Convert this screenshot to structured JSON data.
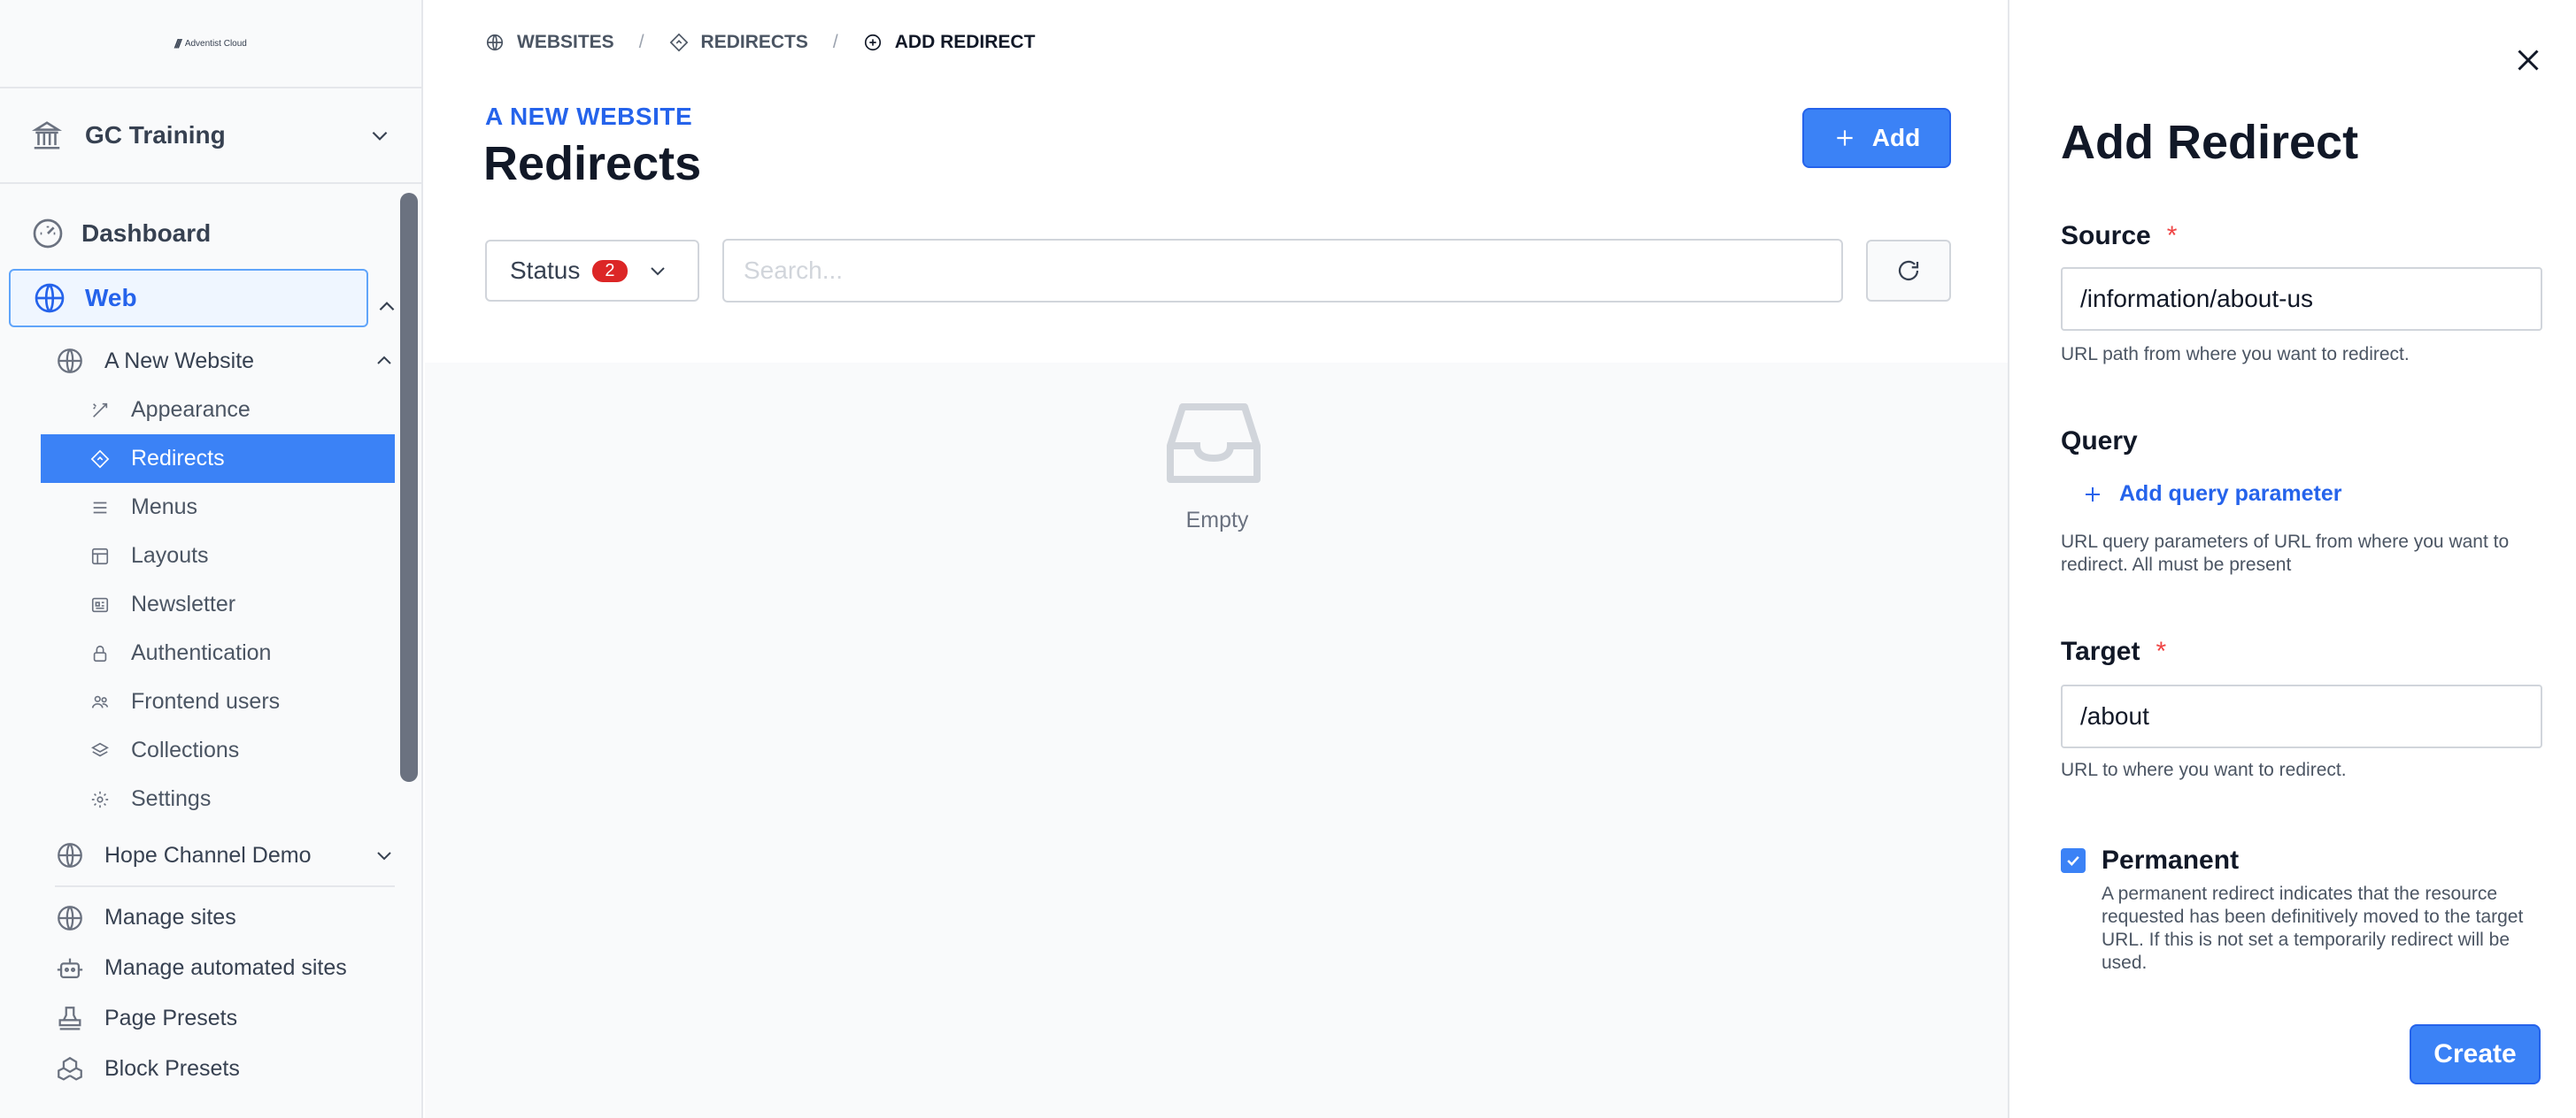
{
  "sidebar": {
    "logo_text": "Adventist Cloud",
    "org_name": "GC Training",
    "dashboard": "Dashboard",
    "web": "Web",
    "site_name": "A New Website",
    "subitems": [
      {
        "label": "Appearance",
        "icon": "wand-icon"
      },
      {
        "label": "Redirects",
        "icon": "diamond-arrow-icon"
      },
      {
        "label": "Menus",
        "icon": "list-icon"
      },
      {
        "label": "Layouts",
        "icon": "layout-icon"
      },
      {
        "label": "Newsletter",
        "icon": "newsletter-icon"
      },
      {
        "label": "Authentication",
        "icon": "lock-icon"
      },
      {
        "label": "Frontend users",
        "icon": "users-icon"
      },
      {
        "label": "Collections",
        "icon": "layers-icon"
      },
      {
        "label": "Settings",
        "icon": "gear-icon"
      }
    ],
    "other_site": "Hope Channel Demo",
    "manage_sites": "Manage sites",
    "manage_automated": "Manage automated sites",
    "page_presets": "Page Presets",
    "block_presets": "Block Presets"
  },
  "breadcrumb": {
    "websites": "WEBSITES",
    "redirects": "REDIRECTS",
    "add_redirect": "ADD REDIRECT"
  },
  "main": {
    "subtitle": "A NEW WEBSITE",
    "title": "Redirects",
    "add_label": "Add",
    "status_label": "Status",
    "status_count": "2",
    "search_placeholder": "Search...",
    "empty_text": "Empty"
  },
  "drawer": {
    "title": "Add Redirect",
    "source_label": "Source",
    "required_mark": "*",
    "source_value": "/information/about-us",
    "source_help": "URL path from where you want to redirect.",
    "query_label": "Query",
    "add_query": "Add query parameter",
    "query_help": "URL query parameters of URL from where you want to redirect. All must be present",
    "target_label": "Target",
    "target_value": "/about",
    "target_help": "URL to where you want to redirect.",
    "permanent_label": "Permanent",
    "permanent_checked": true,
    "permanent_help": "A permanent redirect indicates that the resource requested has been definitively moved to the target URL. If this is not set a temporarily redirect will be used.",
    "create_label": "Create"
  },
  "colors": {
    "accent": "#3b82f6",
    "accent_text": "#2563eb",
    "danger": "#dc2626"
  }
}
